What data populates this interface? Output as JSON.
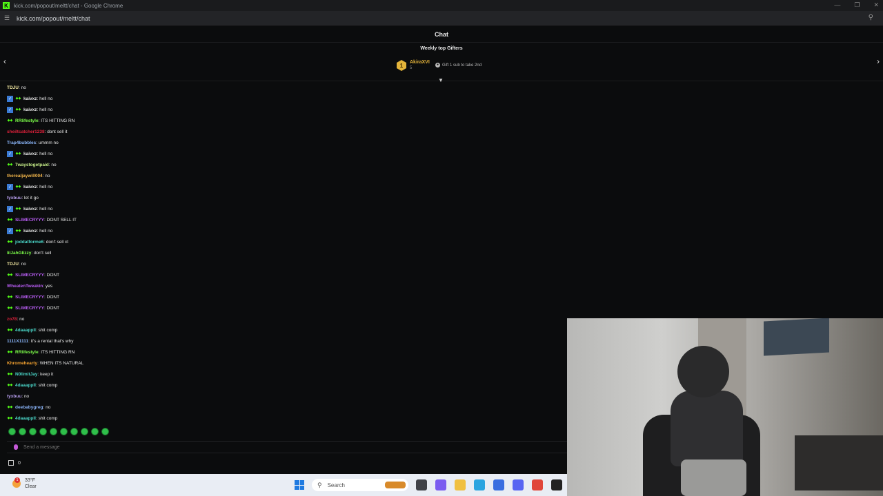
{
  "window": {
    "title": "kick.com/popout/meltt/chat - Google Chrome"
  },
  "browser": {
    "url": "kick.com/popout/meltt/chat"
  },
  "chat": {
    "header": "Chat"
  },
  "gifters": {
    "title": "Weekly top Gifters",
    "top": {
      "rank": "1",
      "name": "AkiraXVI",
      "count": "5"
    },
    "hint": "Gift 1 sub to take 2nd"
  },
  "messages": [
    {
      "badges": [],
      "user": "TDJU",
      "color": "#f0e6a0",
      "text": "no"
    },
    {
      "badges": [
        "v",
        "s"
      ],
      "user": "kaivxz",
      "color": "#e8e8e8",
      "text": "hell no"
    },
    {
      "badges": [
        "v",
        "s"
      ],
      "user": "kaivxz",
      "color": "#e8e8e8",
      "text": "hell no"
    },
    {
      "badges": [
        "s"
      ],
      "user": "RRlifestyle",
      "color": "#7dff4a",
      "text": "ITS HITTING RN"
    },
    {
      "badges": [],
      "user": "sheiltcatcher1238",
      "color": "#e0213b",
      "text": "dont sell it"
    },
    {
      "badges": [],
      "user": "Trap4bubbles",
      "color": "#8ab4f8",
      "text": "ummm no"
    },
    {
      "badges": [
        "v",
        "s"
      ],
      "user": "kaivxz",
      "color": "#e8e8e8",
      "text": "hell no"
    },
    {
      "badges": [
        "s"
      ],
      "user": "7waystogetpaid",
      "color": "#c8f08a",
      "text": "no"
    },
    {
      "badges": [],
      "user": "therealjaywill004",
      "color": "#f0b44a",
      "text": "no"
    },
    {
      "badges": [
        "v",
        "s"
      ],
      "user": "kaivxz",
      "color": "#e8e8e8",
      "text": "hell no"
    },
    {
      "badges": [],
      "user": "tyxbuu",
      "color": "#b9a0f0",
      "text": "let it go"
    },
    {
      "badges": [
        "v",
        "s"
      ],
      "user": "kaivxz",
      "color": "#e8e8e8",
      "text": "hell no"
    },
    {
      "badges": [
        "s"
      ],
      "user": "SLIMECRYYY",
      "color": "#b65cf0",
      "text": "DONT SELL IT"
    },
    {
      "badges": [
        "v",
        "s"
      ],
      "user": "kaivxz",
      "color": "#e8e8e8",
      "text": "hell no"
    },
    {
      "badges": [
        "s"
      ],
      "user": "joddatforme6",
      "color": "#4ad6c8",
      "text": "don't sell ct"
    },
    {
      "badges": [],
      "user": "lilJahGlizzy",
      "color": "#7dff4a",
      "text": "don't sell"
    },
    {
      "badges": [],
      "user": "TDJU",
      "color": "#f0e6a0",
      "text": "no"
    },
    {
      "badges": [
        "s"
      ],
      "user": "SLIMECRYYY",
      "color": "#b65cf0",
      "text": "DONT"
    },
    {
      "badges": [],
      "user": "WheatenTweakin",
      "color": "#b65cf0",
      "text": "yes"
    },
    {
      "badges": [
        "s"
      ],
      "user": "SLIMECRYYY",
      "color": "#b65cf0",
      "text": "DONT"
    },
    {
      "badges": [
        "s"
      ],
      "user": "SLIMECRYYY",
      "color": "#b65cf0",
      "text": "DONT"
    },
    {
      "badges": [],
      "user": "zo78",
      "color": "#e0213b",
      "text": "no"
    },
    {
      "badges": [
        "s"
      ],
      "user": "4daaappll",
      "color": "#4ad6c8",
      "text": "shit comp"
    },
    {
      "badges": [],
      "user": "1111X1111",
      "color": "#8ab4f8",
      "text": "it's a rental that's why"
    },
    {
      "badges": [
        "s"
      ],
      "user": "RRlifestyle",
      "color": "#7dff4a",
      "text": "ITS HITTING RN"
    },
    {
      "badges": [],
      "user": "Khromehearty",
      "color": "#f0a030",
      "text": "WHEN ITS NATURAL"
    },
    {
      "badges": [
        "s"
      ],
      "user": "N0limitJay",
      "color": "#4ad6c8",
      "text": "keep it"
    },
    {
      "badges": [
        "s"
      ],
      "user": "4daaappll",
      "color": "#4ad6c8",
      "text": "shit comp"
    },
    {
      "badges": [],
      "user": "tyxbuu",
      "color": "#b9a0f0",
      "text": "no"
    },
    {
      "badges": [
        "s"
      ],
      "user": "deebabygreg",
      "color": "#8ab4f8",
      "text": "no"
    },
    {
      "badges": [
        "s"
      ],
      "user": "4daaappll",
      "color": "#4ad6c8",
      "text": "shit comp"
    }
  ],
  "emote_count": 10,
  "input": {
    "placeholder": "Send a message"
  },
  "footer": {
    "count": "0"
  },
  "taskbar": {
    "weather_temp": "33°F",
    "weather_desc": "Clear",
    "weather_badge": "1",
    "search": "Search",
    "icons": [
      {
        "name": "task-view-icon",
        "color": "#404248"
      },
      {
        "name": "copilot-icon",
        "color": "#7a5cf0"
      },
      {
        "name": "file-explorer-icon",
        "color": "#f0c040"
      },
      {
        "name": "edge-icon",
        "color": "#2aa4e0"
      },
      {
        "name": "store-icon",
        "color": "#3a6ee0"
      },
      {
        "name": "discord-icon",
        "color": "#5865f2"
      },
      {
        "name": "chrome-icon",
        "color": "#e0463a"
      },
      {
        "name": "app-icon",
        "color": "#222222"
      }
    ]
  }
}
